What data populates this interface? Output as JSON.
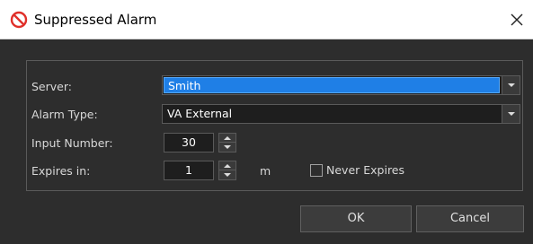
{
  "window": {
    "title": "Suppressed Alarm",
    "title_icon": "prohibited-icon",
    "close_icon": "close-icon"
  },
  "form": {
    "server": {
      "label": "Server:",
      "value": "Smith"
    },
    "alarm_type": {
      "label": "Alarm Type:",
      "value": "VA External"
    },
    "input_number": {
      "label": "Input Number:",
      "value": "30"
    },
    "expires_in": {
      "label": "Expires in:",
      "value": "1",
      "unit": "m"
    },
    "never_expires": {
      "label": "Never Expires",
      "checked": false
    }
  },
  "buttons": {
    "ok": "OK",
    "cancel": "Cancel"
  },
  "colors": {
    "selection": "#1f7fe6",
    "dialog_bg": "#2d2d2d",
    "titlebar_bg": "#ffffff",
    "icon_red": "#e0302a"
  }
}
